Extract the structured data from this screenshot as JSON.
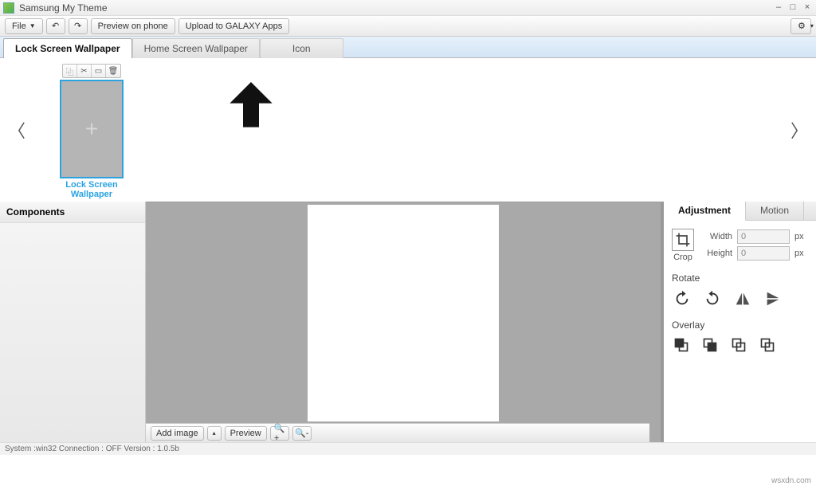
{
  "titlebar": {
    "title": "Samsung My Theme"
  },
  "toolbar": {
    "file_label": "File",
    "preview_label": "Preview on phone",
    "upload_label": "Upload to GALAXY Apps"
  },
  "tabs": {
    "lock": "Lock Screen Wallpaper",
    "home": "Home Screen Wallpaper",
    "icon": "Icon"
  },
  "gallery_item": {
    "label": "Lock Screen Wallpaper"
  },
  "components": {
    "title": "Components"
  },
  "right": {
    "tabs": {
      "adjustment": "Adjustment",
      "motion": "Motion"
    },
    "crop_label": "Crop",
    "width_label": "Width",
    "width_val": "0",
    "height_label": "Height",
    "height_val": "0",
    "unit": "px",
    "rotate_label": "Rotate",
    "overlay_label": "Overlay"
  },
  "bottom": {
    "add_image": "Add image",
    "preview": "Preview"
  },
  "status": "System :win32 Connection : OFF Version : 1.0.5b",
  "watermark": "wsxdn.com"
}
